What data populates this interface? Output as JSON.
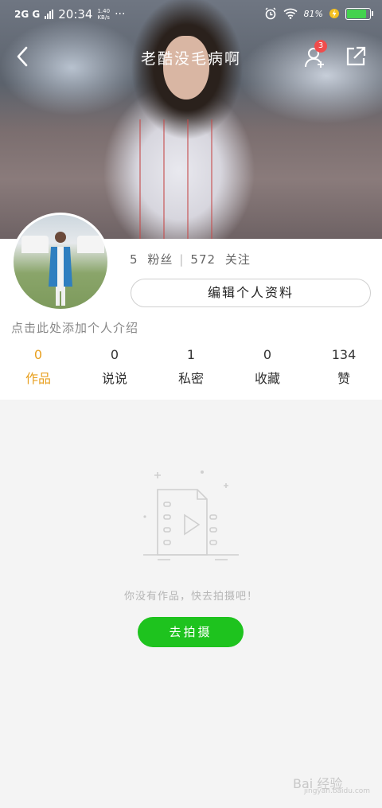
{
  "status_bar": {
    "signal": "2G G",
    "time": "20:34",
    "speed": "1.40\nKB/s",
    "more": "···",
    "battery": "81%"
  },
  "nav": {
    "title": "老酷没毛病啊",
    "notification_count": "3"
  },
  "profile": {
    "fans_count": "5",
    "fans_label": "粉丝",
    "divider": "|",
    "follow_count": "572",
    "follow_label": "关注",
    "edit_button": "编辑个人资料",
    "intro_placeholder": "点击此处添加个人介绍"
  },
  "stats": [
    {
      "value": "0",
      "label": "作品",
      "active": true
    },
    {
      "value": "0",
      "label": "说说",
      "active": false
    },
    {
      "value": "1",
      "label": "私密",
      "active": false
    },
    {
      "value": "0",
      "label": "收藏",
      "active": false
    },
    {
      "value": "134",
      "label": "赞",
      "active": false
    }
  ],
  "empty_state": {
    "message": "你没有作品，快去拍摄吧！",
    "button": "去拍摄"
  },
  "watermark": {
    "text": "Bai 经验",
    "sub": "jingyan.baidu.com"
  },
  "colors": {
    "accent": "#e8a020",
    "primary_button": "#1ec31e",
    "badge": "#f04c4c"
  }
}
